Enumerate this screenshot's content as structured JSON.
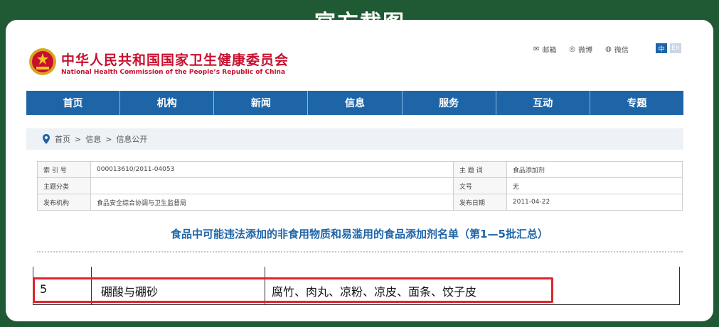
{
  "banner": {
    "title": "官方截图"
  },
  "site": {
    "title_cn": "中华人民共和国国家卫生健康委员会",
    "title_en": "National Health Commission of the People’s Republic of China"
  },
  "top_links": [
    {
      "label": "邮箱",
      "icon": "mail-icon"
    },
    {
      "label": "微博",
      "icon": "weibo-icon"
    },
    {
      "label": "微信",
      "icon": "wechat-icon"
    }
  ],
  "lang": {
    "cn": "中",
    "en": "En"
  },
  "nav": [
    "首页",
    "机构",
    "新闻",
    "信息",
    "服务",
    "互动",
    "专题"
  ],
  "breadcrumb": {
    "home": "首页",
    "sep": ">",
    "level1": "信息",
    "level2": "信息公开"
  },
  "meta": {
    "index_label": "索 引 号",
    "index_value": "000013610/2011-04053",
    "topic_label": "主 题 词",
    "topic_value": "食品添加剂",
    "category_label": "主题分类",
    "category_value": "",
    "docno_label": "文号",
    "docno_value": "无",
    "issuer_label": "发布机构",
    "issuer_value": "食品安全综合协调与卫生监督局",
    "date_label": "发布日期",
    "date_value": "2011-04-22"
  },
  "doc_title": "食品中可能违法添加的非食用物质和易滥用的食品添加剂名单（第1—5批汇总）",
  "row": {
    "no": "5",
    "substance": "硼酸与硼砂",
    "foods": "腐竹、肉丸、凉粉、凉皮、面条、饺子皮"
  },
  "colors": {
    "brand_green": "#1f5a34",
    "nav_blue": "#1e65a8",
    "title_red": "#c8102e",
    "highlight_red": "#e0232e"
  }
}
